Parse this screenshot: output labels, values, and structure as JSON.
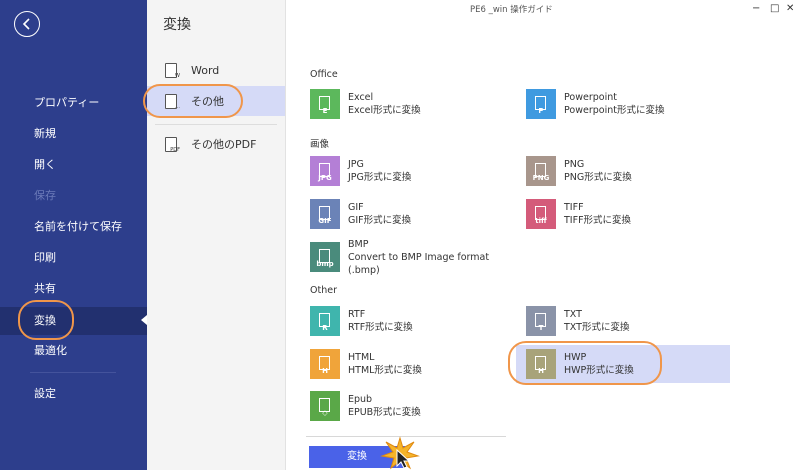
{
  "window": {
    "title": "PE6 _win 操作ガイド",
    "minimize": "−",
    "maximize": "□",
    "close": "✕"
  },
  "leftnav": {
    "items": [
      {
        "label": "プロパティー"
      },
      {
        "label": "新規"
      },
      {
        "label": "開く"
      },
      {
        "label": "保存"
      },
      {
        "label": "名前を付けて保存"
      },
      {
        "label": "印刷"
      },
      {
        "label": "共有"
      },
      {
        "label": "変換"
      },
      {
        "label": "最適化"
      },
      {
        "label": "設定"
      }
    ]
  },
  "midcol": {
    "title": "変換",
    "items": [
      {
        "label": "Word",
        "icon_letter": "W"
      },
      {
        "label": "その他",
        "icon_letter": "…"
      },
      {
        "label": "その他のPDF",
        "icon_letter": "PDF"
      }
    ]
  },
  "main": {
    "sections": {
      "office": "Office",
      "image": "画像",
      "other": "Other"
    },
    "formats": [
      {
        "key": "excel",
        "name": "Excel",
        "desc": "Excel形式に変換",
        "letter": "E",
        "color": "#5cb85c"
      },
      {
        "key": "powerpoint",
        "name": "Powerpoint",
        "desc": "Powerpoint形式に変換",
        "letter": "P",
        "color": "#3f9ae0"
      },
      {
        "key": "jpg",
        "name": "JPG",
        "desc": "JPG形式に変換",
        "letter": "JPG",
        "color": "#b47fd6"
      },
      {
        "key": "png",
        "name": "PNG",
        "desc": "PNG形式に変換",
        "letter": "PNG",
        "color": "#a8968c"
      },
      {
        "key": "gif",
        "name": "GIF",
        "desc": "GIF形式に変換",
        "letter": "GIF",
        "color": "#6b83b7"
      },
      {
        "key": "tiff",
        "name": "TIFF",
        "desc": "TIFF形式に変換",
        "letter": "tiff",
        "color": "#d45b7a"
      },
      {
        "key": "bmp",
        "name": "BMP",
        "desc": "Convert to BMP Image format (.bmp)",
        "letter": "bmp",
        "color": "#4a8b7c"
      },
      {
        "key": "rtf",
        "name": "RTF",
        "desc": "RTF形式に変換",
        "letter": "R",
        "color": "#3fb5ad"
      },
      {
        "key": "txt",
        "name": "TXT",
        "desc": "TXT形式に変換",
        "letter": "T",
        "color": "#8a93a8"
      },
      {
        "key": "html",
        "name": "HTML",
        "desc": "HTML形式に変換",
        "letter": "H",
        "color": "#f0a43a"
      },
      {
        "key": "hwp",
        "name": "HWP",
        "desc": "HWP形式に変換",
        "letter": "H",
        "color": "#a8a37a"
      },
      {
        "key": "epub",
        "name": "Epub",
        "desc": "EPUB形式に変換",
        "letter": "◇",
        "color": "#5aa848"
      }
    ],
    "convert_label": "変換"
  },
  "colors": {
    "nav_bg": "#2d3e8c",
    "accent": "#4a62e8",
    "highlight": "#f0964a",
    "selected_bg": "#d5daf7"
  }
}
